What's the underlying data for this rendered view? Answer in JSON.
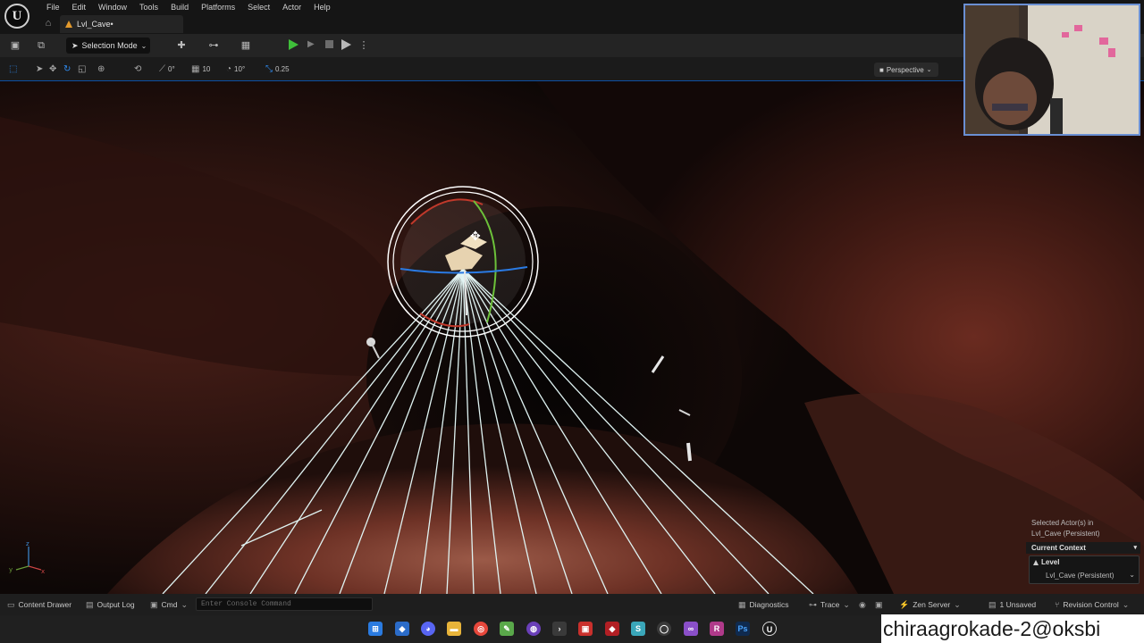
{
  "menubar": {
    "items": [
      "File",
      "Edit",
      "Window",
      "Tools",
      "Build",
      "Platforms",
      "Select",
      "Actor",
      "Help"
    ]
  },
  "tab": {
    "label": "Lvl_Cave•"
  },
  "toolbar": {
    "mode_label": "Selection Mode"
  },
  "viewport_toolbar": {
    "rotation_snap": "0°",
    "grid_snap": "10",
    "angle_snap": "10°",
    "scale_snap": "0.25",
    "view_mode": "Perspective"
  },
  "context_panel": {
    "selected_line1": "Selected Actor(s) in",
    "selected_line2": "Lvl_Cave (Persistent)",
    "current_context": "Current Context",
    "level_label": "Level",
    "level_value": "Lvl_Cave (Persistent)"
  },
  "statusbar": {
    "content_drawer": "Content Drawer",
    "output_log": "Output Log",
    "cmd": "Cmd",
    "console_placeholder": "Enter Console Command",
    "diagnostics": "Diagnostics",
    "trace": "Trace",
    "zen_server": "Zen Server",
    "unsaved": "1 Unsaved",
    "revision_control": "Revision Control"
  },
  "taskbar": {
    "icons": [
      "windows-start-icon",
      "app-icon",
      "discord-icon",
      "file-explorer-icon",
      "chrome-icon",
      "notepad-icon",
      "github-icon",
      "terminal-icon",
      "app2-icon",
      "app3-icon",
      "app4-icon",
      "app5-icon",
      "visual-studio-icon",
      "rider-icon",
      "photoshop-icon",
      "unreal-icon"
    ]
  },
  "watermark": {
    "text": "chiraagrokade-2@oksbi"
  },
  "colors": {
    "accent_blue": "#0d4fa3",
    "play_green": "#3fbf3a",
    "level_orange": "#e39a2d"
  }
}
